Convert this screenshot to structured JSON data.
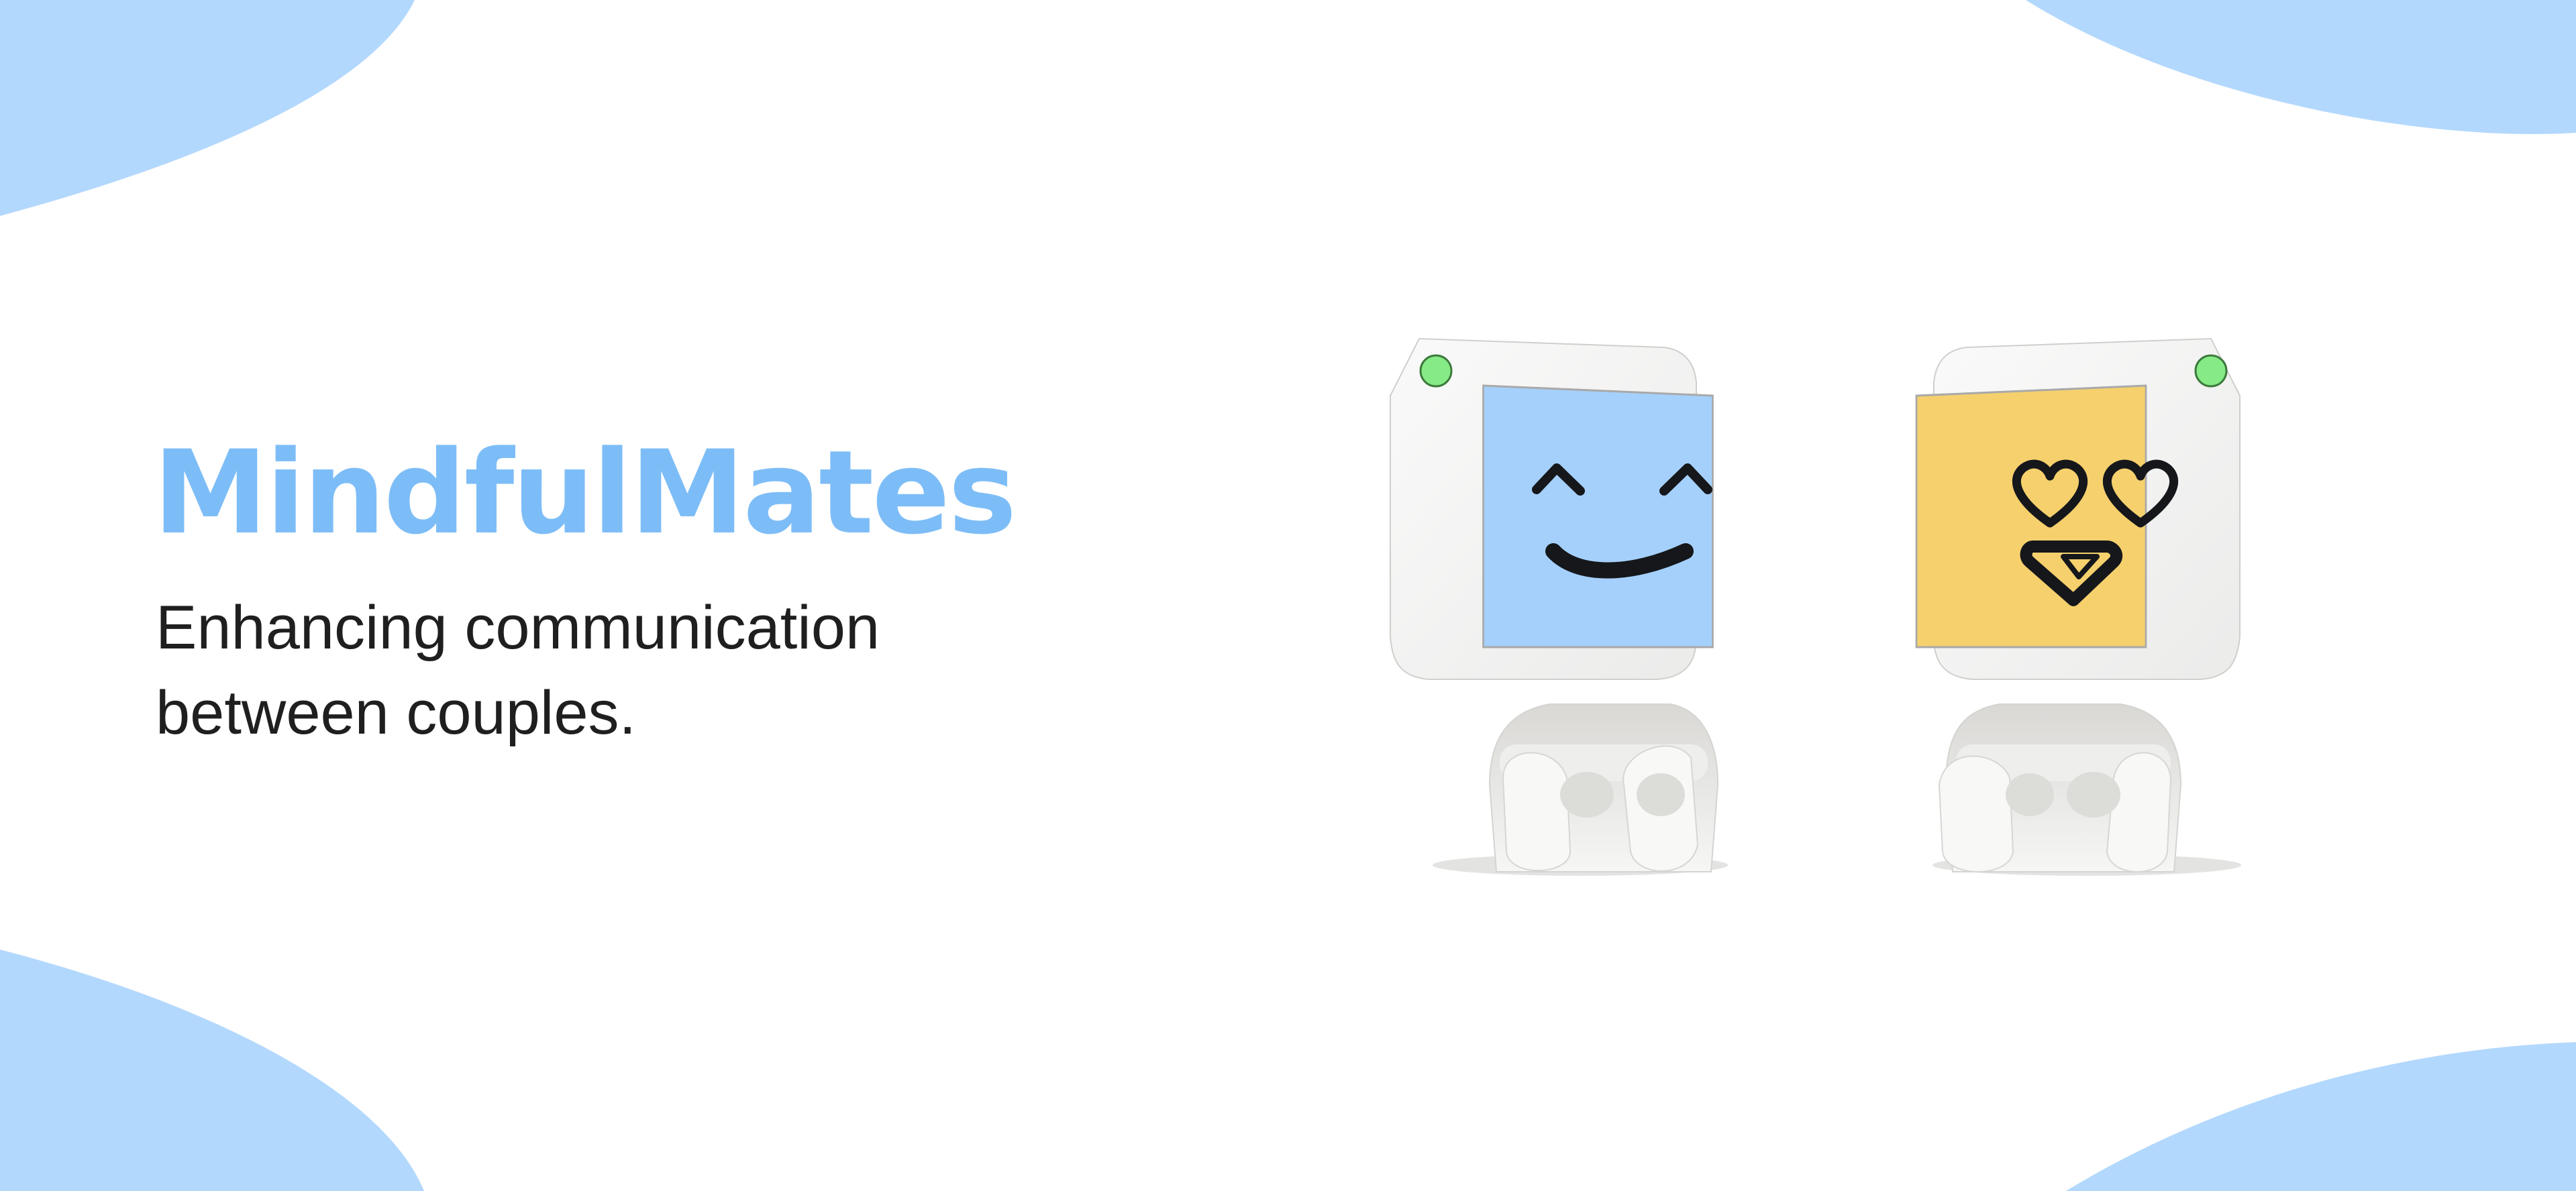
{
  "brand": {
    "title": "MindfulMates"
  },
  "hero": {
    "tagline": "Enhancing communication between couples."
  },
  "colors": {
    "accent": "#7dbdf7",
    "blob": "#b3d8fd",
    "text": "#1f1f1f",
    "screen_blue": "#a5d0fb",
    "screen_yellow": "#f5d06d",
    "led_green": "#86ea86",
    "body_white": "#f3f3f2"
  },
  "robots": [
    {
      "name": "robot-left",
      "expression": "happy-smiling-face-icon",
      "screen_color": "#a5d0fb"
    },
    {
      "name": "robot-right",
      "expression": "heart-eyes-face-icon",
      "screen_color": "#f5d06d"
    }
  ]
}
